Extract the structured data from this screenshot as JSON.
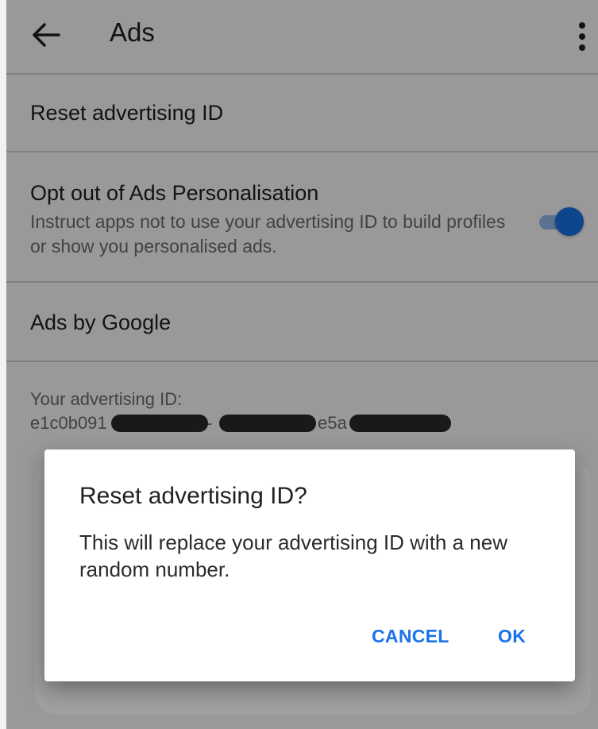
{
  "appbar": {
    "title": "Ads",
    "back_icon": "arrow-back-icon",
    "menu_icon": "more-vert-icon"
  },
  "settings": {
    "reset_id": {
      "title": "Reset advertising ID"
    },
    "opt_out": {
      "title": "Opt out of Ads Personalisation",
      "subtitle": "Instruct apps not to use your advertising ID to build profiles or show you personalised ads.",
      "enabled": true
    },
    "ads_by_google": {
      "title": "Ads by Google"
    },
    "advertising_id": {
      "label": "Your advertising ID:",
      "value_part1": "e1c0b091",
      "value_part2": "-",
      "value_part3": "e5a"
    }
  },
  "dialog": {
    "title": "Reset advertising ID?",
    "body": "This will replace your advertising ID with a new random number.",
    "cancel_label": "CANCEL",
    "ok_label": "OK"
  },
  "colors": {
    "accent": "#1a73e8",
    "scrim": "rgba(0,0,0,0.40)"
  }
}
